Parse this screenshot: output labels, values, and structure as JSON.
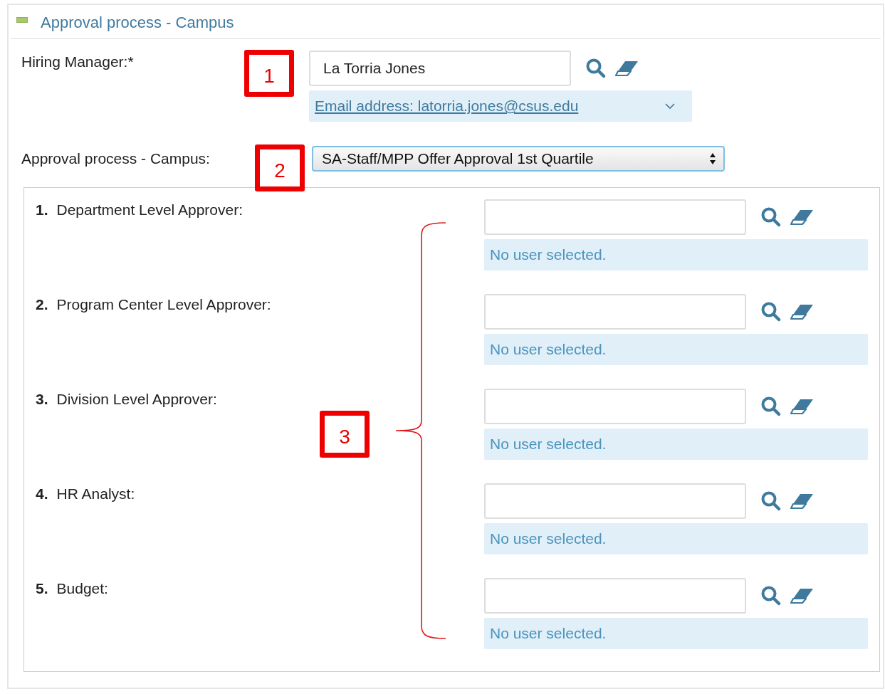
{
  "panel": {
    "title": "Approval process - Campus",
    "expanded": true
  },
  "hiring_manager": {
    "label": "Hiring Manager:*",
    "value": "La Torria Jones",
    "email": "Email address: latorria.jones@csus.edu"
  },
  "approval_process": {
    "label": "Approval process - Campus:",
    "value": "SA-Staff/MPP Offer Approval 1st Quartile"
  },
  "approvers": [
    {
      "number": "1.",
      "label": "Department Level Approver:",
      "status": "No user selected."
    },
    {
      "number": "2.",
      "label": "Program Center Level Approver:",
      "status": "No user selected."
    },
    {
      "number": "3.",
      "label": "Division Level Approver:",
      "status": "No user selected."
    },
    {
      "number": "4.",
      "label": "HR Analyst:",
      "status": "No user selected."
    },
    {
      "number": "5.",
      "label": "Budget:",
      "status": "No user selected."
    }
  ],
  "callouts": [
    {
      "text": "1"
    },
    {
      "text": "2"
    },
    {
      "text": "3"
    }
  ]
}
